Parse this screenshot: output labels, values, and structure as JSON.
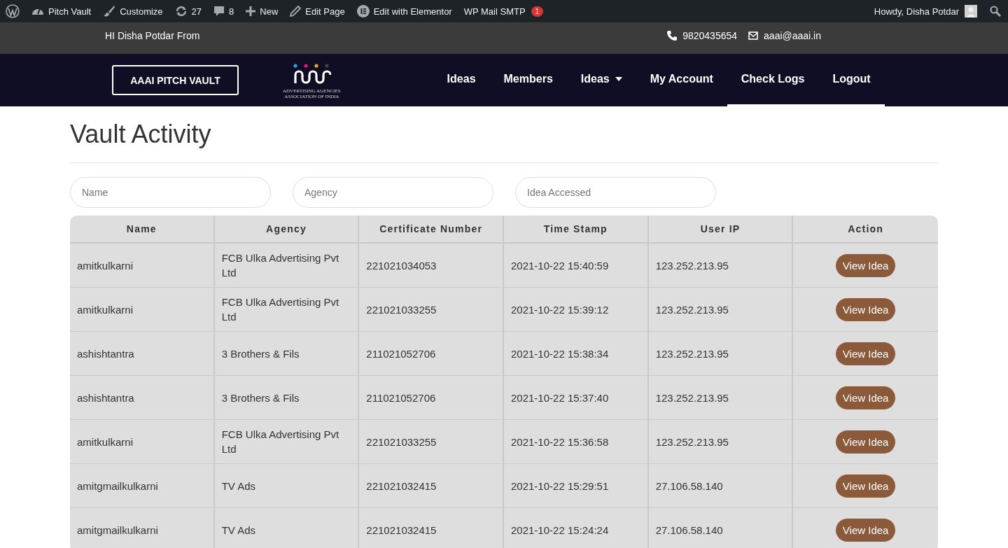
{
  "admin_bar": {
    "items": [
      {
        "kind": "wp"
      },
      {
        "kind": "dashboard",
        "label": "Pitch Vault"
      },
      {
        "kind": "brush",
        "label": "Customize"
      },
      {
        "kind": "updates",
        "label": "27"
      },
      {
        "kind": "comments",
        "label": "8"
      },
      {
        "kind": "plus",
        "label": "New"
      },
      {
        "kind": "pencil",
        "label": "Edit Page"
      },
      {
        "kind": "elementor",
        "label": "Edit with Elementor"
      },
      {
        "kind": "text",
        "label": "WP Mail SMTP",
        "badge": "1"
      }
    ],
    "greeting": "Howdy, Disha Potdar"
  },
  "top_bar": {
    "greeting": "HI Disha Potdar From",
    "phone": "9820435654",
    "email": "aaai@aaai.in"
  },
  "header": {
    "brand_button": "AAAI PITCH VAULT",
    "logo_caption_1": "ADVERTISING AGENCIES",
    "logo_caption_2": "ASSOCIATION OF INDIA",
    "nav": [
      {
        "label": "Ideas",
        "selected": false,
        "dropdown": false
      },
      {
        "label": "Members",
        "selected": false,
        "dropdown": false
      },
      {
        "label": "Ideas",
        "selected": false,
        "dropdown": true
      },
      {
        "label": "My Account",
        "selected": false,
        "dropdown": false
      },
      {
        "label": "Check Logs",
        "selected": true,
        "dropdown": false
      },
      {
        "label": "Logout",
        "selected": true,
        "dropdown": false
      }
    ]
  },
  "page_title": "Vault Activity",
  "filters": [
    {
      "placeholder": "Name"
    },
    {
      "placeholder": "Agency"
    },
    {
      "placeholder": "Idea Accessed"
    }
  ],
  "table": {
    "columns": [
      "Name",
      "Agency",
      "Certificate Number",
      "Time Stamp",
      "User IP",
      "Action"
    ],
    "rows": [
      {
        "name": "amitkulkarni",
        "agency": "FCB Ulka Advertising Pvt Ltd",
        "certificate": "221021034053",
        "timestamp": "2021-10-22 15:40:59",
        "ip": "123.252.213.95",
        "action": "View Idea"
      },
      {
        "name": "amitkulkarni",
        "agency": "FCB Ulka Advertising Pvt Ltd",
        "certificate": "221021033255",
        "timestamp": "2021-10-22 15:39:12",
        "ip": "123.252.213.95",
        "action": "View Idea"
      },
      {
        "name": "ashishtantra",
        "agency": "3 Brothers & Fils",
        "certificate": "211021052706",
        "timestamp": "2021-10-22 15:38:34",
        "ip": "123.252.213.95",
        "action": "View Idea"
      },
      {
        "name": "ashishtantra",
        "agency": "3 Brothers & Fils",
        "certificate": "211021052706",
        "timestamp": "2021-10-22 15:37:40",
        "ip": "123.252.213.95",
        "action": "View Idea"
      },
      {
        "name": "amitkulkarni",
        "agency": "FCB Ulka Advertising Pvt Ltd",
        "certificate": "221021033255",
        "timestamp": "2021-10-22 15:36:58",
        "ip": "123.252.213.95",
        "action": "View Idea"
      },
      {
        "name": "amitgmailkulkarni",
        "agency": "TV Ads",
        "certificate": "221021032415",
        "timestamp": "2021-10-22 15:29:51",
        "ip": "27.106.58.140",
        "action": "View Idea"
      },
      {
        "name": "amitgmailkulkarni",
        "agency": "TV Ads",
        "certificate": "221021032415",
        "timestamp": "2021-10-22 15:24:24",
        "ip": "27.106.58.140",
        "action": "View Idea"
      }
    ]
  }
}
